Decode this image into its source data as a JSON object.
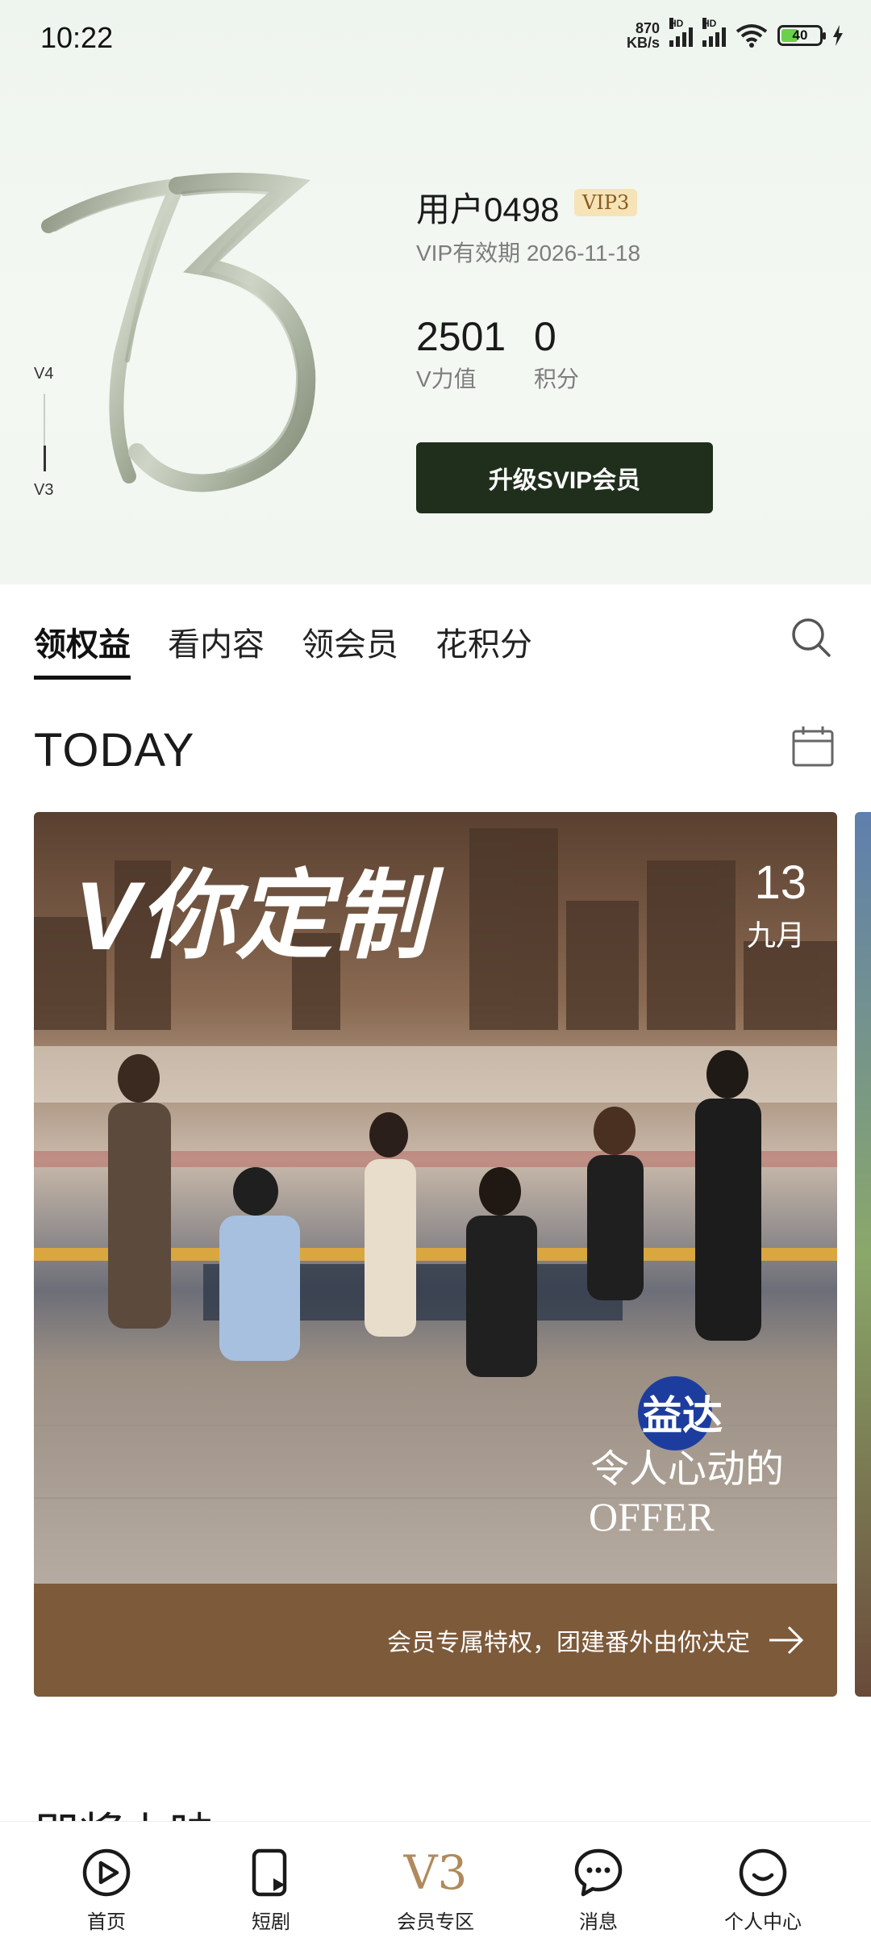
{
  "status_bar": {
    "time": "10:22",
    "net_speed_value": "870",
    "net_speed_unit": "KB/s",
    "signal_label": "HD",
    "battery": "40"
  },
  "profile": {
    "user_name": "用户0498",
    "vip_level": "VIP3",
    "vip_expire": "VIP有效期 2026-11-18",
    "level_next": "V4",
    "level_current": "V3",
    "level_art_number": "13",
    "stats": [
      {
        "value": "2501",
        "label": "V力值"
      },
      {
        "value": "0",
        "label": "积分"
      }
    ],
    "upgrade_label": "升级SVIP会员"
  },
  "tabs": [
    {
      "label": "领权益",
      "active": true
    },
    {
      "label": "看内容",
      "active": false
    },
    {
      "label": "领会员",
      "active": false
    },
    {
      "label": "花积分",
      "active": false
    }
  ],
  "today": {
    "title": "TODAY",
    "banner": {
      "headline": "V你定制",
      "day": "13",
      "month": "九月",
      "brand": "益达",
      "show_title": "令人心动的",
      "show_subtitle": "OFFER",
      "caption": "会员专属特权，团建番外由你决定"
    }
  },
  "next_section_title": "即将上映",
  "bottom_nav": [
    {
      "label": "首页",
      "icon": "play-circle-icon"
    },
    {
      "label": "短剧",
      "icon": "short-drama-icon"
    },
    {
      "label": "会员专区",
      "icon": "v3-level-icon",
      "glyph": "V3"
    },
    {
      "label": "消息",
      "icon": "message-icon"
    },
    {
      "label": "个人中心",
      "icon": "profile-smile-icon"
    }
  ],
  "colors": {
    "accent_dark_green": "#1f2f1c",
    "vip_gold": "#b08a5c",
    "card_footer_brown": "#7d5a3a"
  }
}
